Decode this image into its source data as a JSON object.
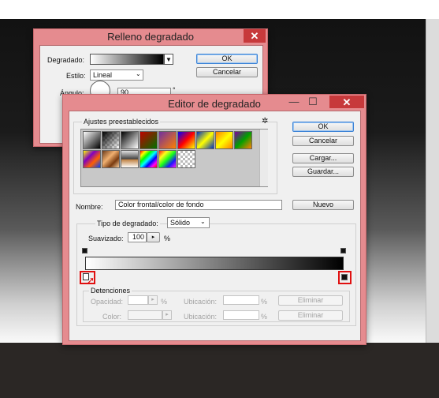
{
  "relleno": {
    "title": "Relleno degradado",
    "close_label": "✕",
    "gradient_label": "Degradado:",
    "style_label": "Estilo:",
    "style_value": "Lineal",
    "angle_label": "Ángulo:",
    "angle_value": "90",
    "angle_unit": "°",
    "ok_label": "OK",
    "cancel_label": "Cancelar"
  },
  "editor": {
    "title": "Editor de degradado",
    "min_label": "—",
    "max_label": "☐",
    "close_label": "✕",
    "presets_label": "Ajustes preestablecidos",
    "gear_label": "✲",
    "ok_label": "OK",
    "cancel_label": "Cancelar",
    "load_label": "Cargar...",
    "save_label": "Guardar...",
    "name_label": "Nombre:",
    "name_value": "Color frontal/color de fondo",
    "new_label": "Nuevo",
    "type_label": "Tipo de degradado:",
    "type_value": "Sólido",
    "smooth_label": "Suavizado:",
    "smooth_value": "100",
    "percent": "%",
    "stops": {
      "title": "Detenciones",
      "opacity_label": "Opacidad:",
      "location_label": "Ubicación:",
      "delete_label": "Eliminar",
      "color_label": "Color:"
    },
    "preset_swatches": [
      "fg-bg",
      "fg-transparent",
      "black-white",
      "red-green",
      "violet-orange",
      "blue-red-yellow",
      "blue-yellow-blue",
      "orange-yellow-orange",
      "violet-green-orange",
      "yellow-violet-orange-blue",
      "copper",
      "chrome",
      "spectrum",
      "transparent-rainbow",
      "transparent-stripes"
    ]
  },
  "colors": {
    "window_frame": "#e58b8f",
    "close_button": "#c7393b",
    "highlight_box": "#e01010"
  }
}
